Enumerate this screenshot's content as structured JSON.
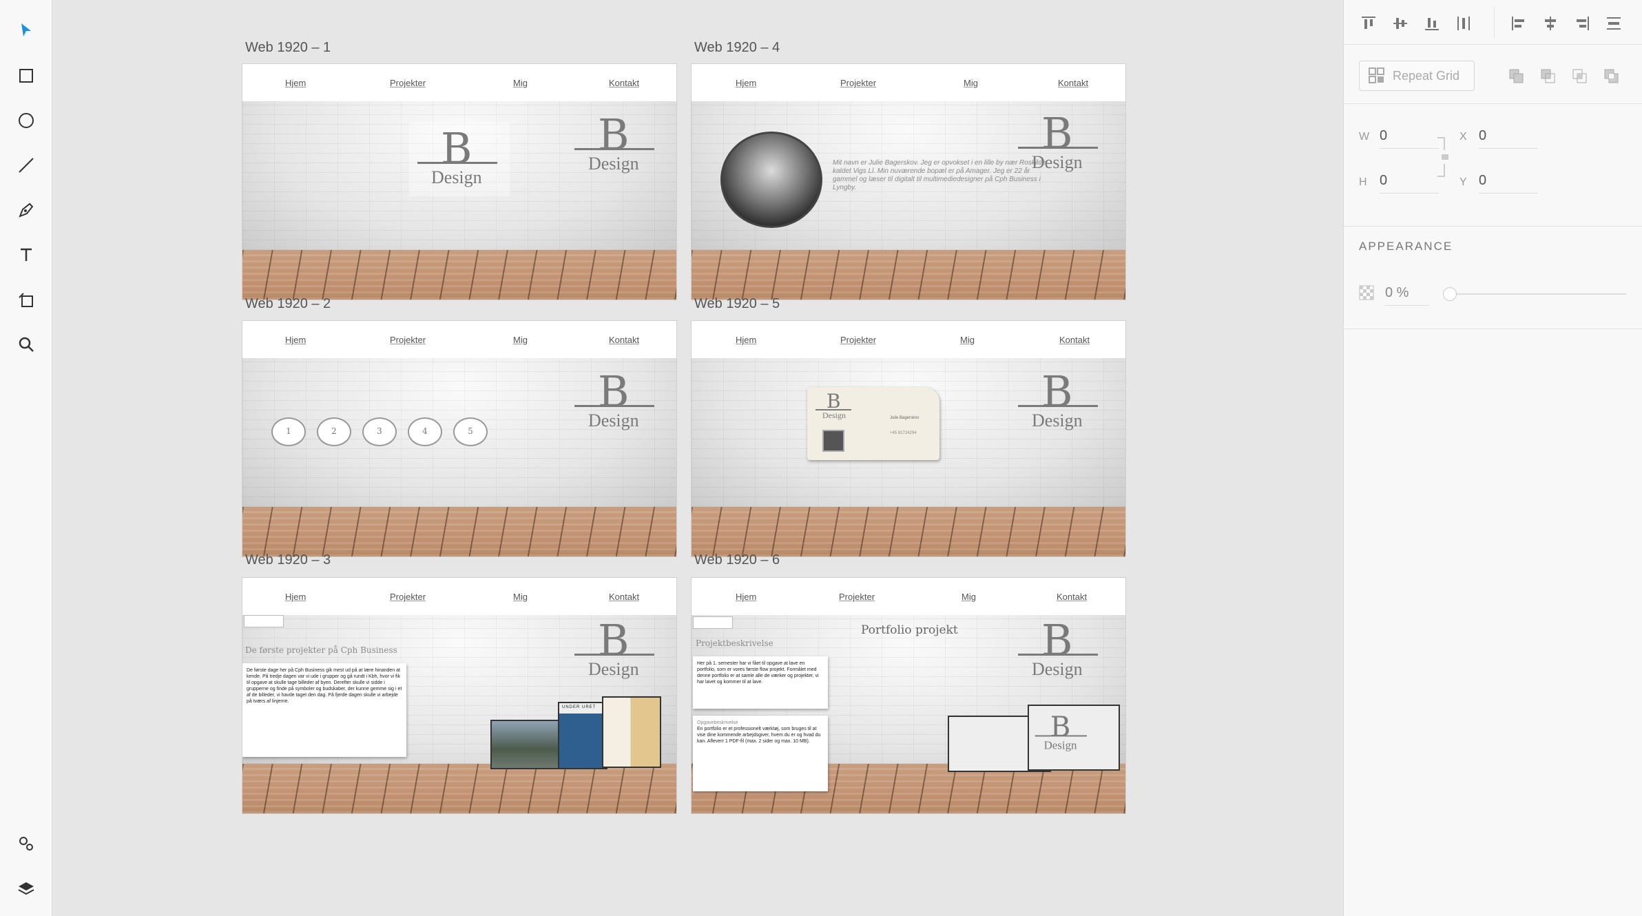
{
  "artboards": [
    {
      "label": "Web 1920 – 1",
      "nav": [
        "Hjem",
        "Projekter",
        "Mig",
        "Kontakt"
      ]
    },
    {
      "label": "Web 1920 – 4",
      "nav": [
        "Hjem",
        "Projekter",
        "Mig",
        "Kontakt"
      ]
    },
    {
      "label": "Web 1920 – 2",
      "nav": [
        "Hjem",
        "Projekter",
        "Mig",
        "Kontakt"
      ]
    },
    {
      "label": "Web 1920 – 5",
      "nav": [
        "Hjem",
        "Projekter",
        "Mig",
        "Kontakt"
      ]
    },
    {
      "label": "Web 1920 – 3",
      "nav": [
        "Hjem",
        "Projekter",
        "Mig",
        "Kontakt"
      ]
    },
    {
      "label": "Web 1920 – 6",
      "nav": [
        "Hjem",
        "Projekter",
        "Mig",
        "Kontakt"
      ]
    }
  ],
  "logo": {
    "letter": "B",
    "word": "Design"
  },
  "ab4_text": "Mit navn er Julie Bagerskov. Jeg er opvokset i en lille by nær Roskilde kaldet Vigs Ll. Min nuværende bopæl er på Amager. Jeg er 22 år gammel og læser til digitalt til multimediedesigner på Cph Business i Lyngby.",
  "ab2_circles": [
    "1",
    "2",
    "3",
    "4",
    "5"
  ],
  "ab5_card": {
    "name": "Julie Bagerskov",
    "phone": "+45 81724294"
  },
  "ab3": {
    "heading": "De første projekter på Cph Business",
    "body": "De første dage her på Cph Business gik mest ud på at lære hinanden at kende. På tredje dagen var vi ude i grupper og gå rundt i Kbh, hvor vi fik til opgave at skulle tage billeder af byen. Derefter skulle vi sidde i grupperne og finde på symboler og budskaber, der kunne gemme sig i et af de billeder, vi havde taget den dag. På fjerde dagen skulle vi arbejde på tværs af linjerne.",
    "thumb_label": "UNDER URET"
  },
  "ab6": {
    "title": "Portfolio projekt",
    "subtitle": "Projektbeskrivelse",
    "box1": "Her på 1. semester har vi fået til opgave at lave en portfolio, som er vores første flow projekt. Formålet med denne portfolio er at samle alle de værker og projekter, vi har lavet og kommer til at lave.",
    "box2_title": "Opgavebeskrivelse",
    "box2": "En portfolio er et professionelt værktøj, som bruges til at vise dine kommende arbejdsgiver, hvem du er og hvad du kan. Afleverr 1 PDF-fil (max. 2 sider og max. 10 MB)."
  },
  "panel": {
    "repeat_grid": "Repeat Grid",
    "w_label": "W",
    "w_value": "0",
    "x_label": "X",
    "x_value": "0",
    "h_label": "H",
    "h_value": "0",
    "y_label": "Y",
    "y_value": "0",
    "appearance": "APPEARANCE",
    "opacity": "0 %"
  },
  "colors": {
    "accent": "#1f8fe0",
    "wall": "#e6e6e6",
    "floor": "#c49474",
    "logo": "#7a7a7a"
  }
}
